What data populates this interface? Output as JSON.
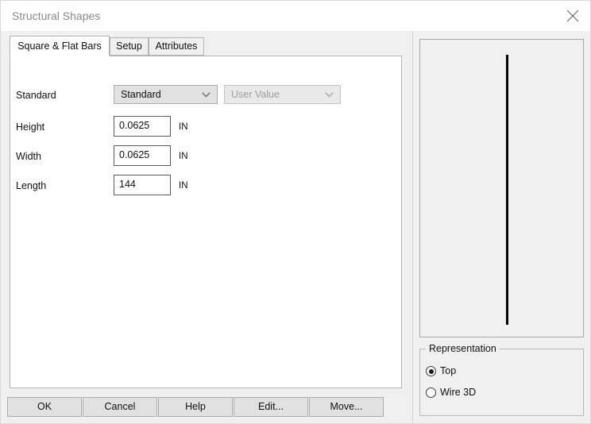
{
  "window": {
    "title": "Structural Shapes",
    "close_icon": "close-icon"
  },
  "tabs": [
    {
      "label": "Square & Flat Bars",
      "active": true
    },
    {
      "label": "Setup",
      "active": false
    },
    {
      "label": "Attributes",
      "active": false
    }
  ],
  "form": {
    "rows": [
      {
        "label": "Standard",
        "type": "combo",
        "value": "Standard"
      },
      {
        "label": "Height",
        "type": "text",
        "value": "0.0625",
        "unit": "IN"
      },
      {
        "label": "Width",
        "type": "text",
        "value": "0.0625",
        "unit": "IN"
      },
      {
        "label": "Length",
        "type": "text",
        "value": "144",
        "unit": "IN"
      }
    ],
    "secondary_combo": {
      "value": "User Value",
      "disabled": true
    }
  },
  "buttons": [
    {
      "label": "OK"
    },
    {
      "label": "Cancel"
    },
    {
      "label": "Help"
    },
    {
      "label": "Edit..."
    },
    {
      "label": "Move..."
    }
  ],
  "representation": {
    "legend": "Representation",
    "options": [
      {
        "label": "Top",
        "selected": true
      },
      {
        "label": "Wire 3D",
        "selected": false
      }
    ]
  },
  "preview": {
    "shape": "vertical-bar-top-view"
  },
  "colors": {
    "title_text": "#8a8a8a",
    "window_bg": "#f0f0f0",
    "panel_bg": "#ffffff",
    "control_bg": "#e1e1e1",
    "border": "#b4b4b4",
    "preview_line": "#000000"
  }
}
